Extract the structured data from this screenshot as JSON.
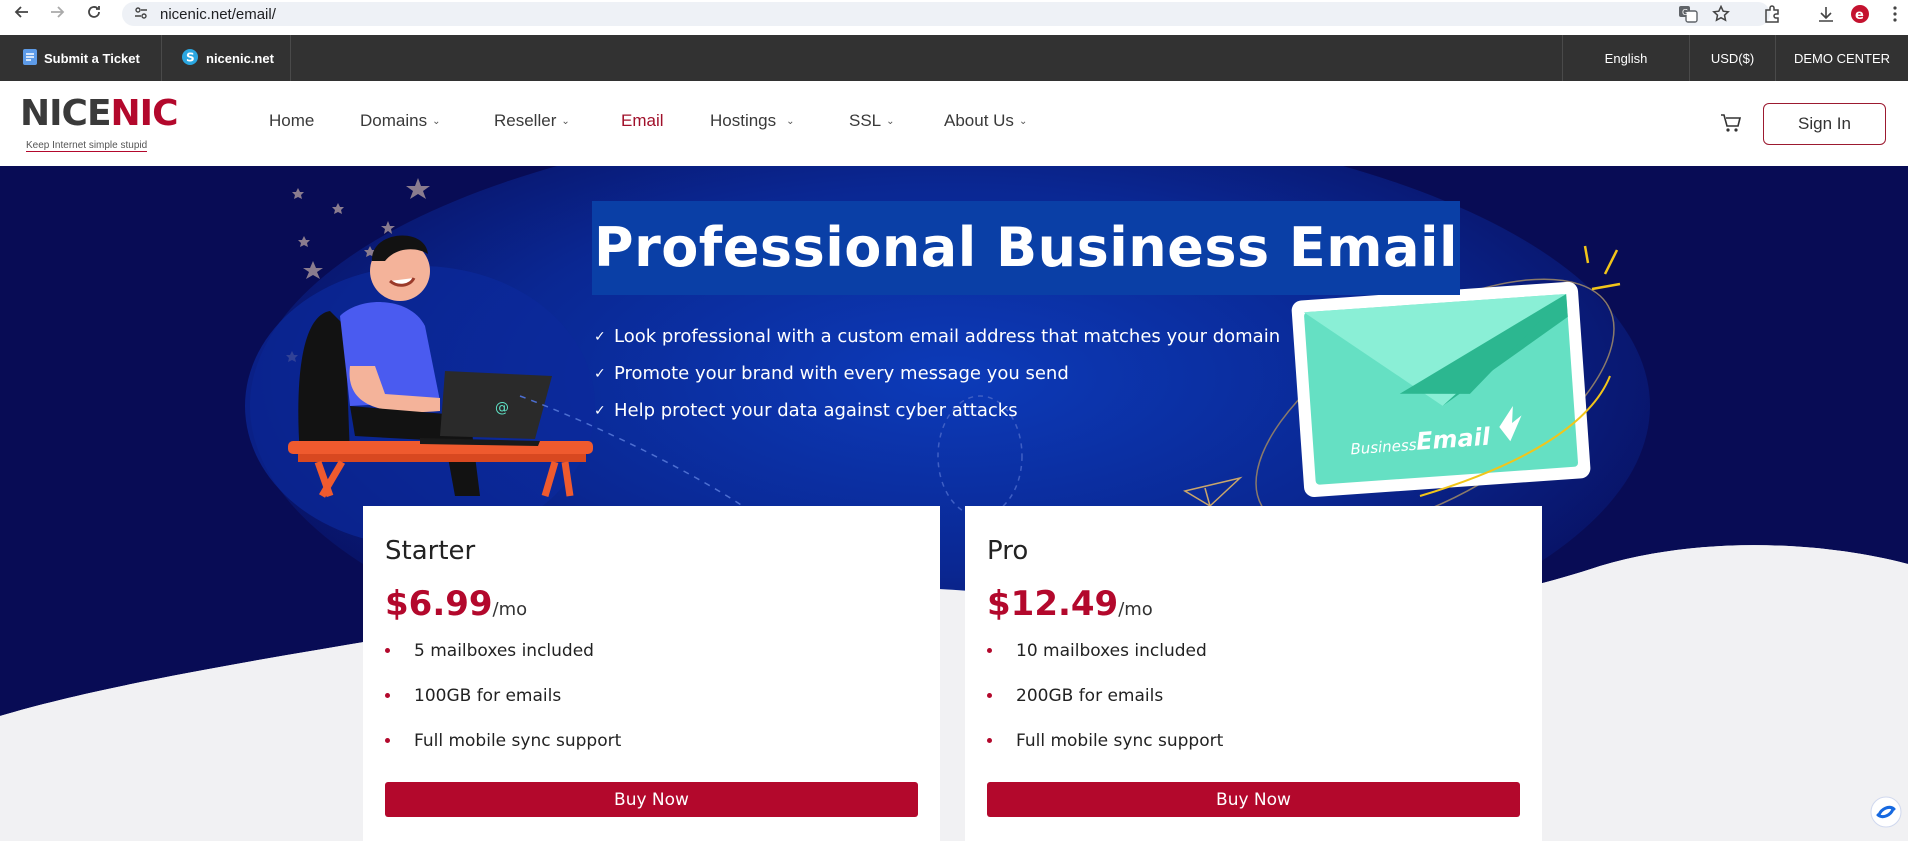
{
  "browser": {
    "url": "nicenic.net/email/"
  },
  "topbar": {
    "ticket_label": "Submit a Ticket",
    "site_label": "nicenic.net",
    "language": "English",
    "currency": "USD($)",
    "demo": "DEMO CENTER"
  },
  "header": {
    "logo_text_1": "NICE",
    "logo_text_2": "NIC",
    "logo_tagline": "Keep Internet simple stupid",
    "nav": [
      {
        "label": "Home",
        "dropdown": false
      },
      {
        "label": "Domains",
        "dropdown": true
      },
      {
        "label": "Reseller",
        "dropdown": true
      },
      {
        "label": "Email",
        "dropdown": false,
        "active": true
      },
      {
        "label": "Hostings",
        "dropdown": true
      },
      {
        "label": "SSL",
        "dropdown": true
      },
      {
        "label": "About Us",
        "dropdown": true
      }
    ],
    "signin_label": "Sign In"
  },
  "hero": {
    "title": "Professional Business Email",
    "bullets": [
      "Look professional with a custom email address that matches your domain",
      "Promote your brand with every message you send",
      "Help protect your data against cyber attacks"
    ],
    "envelope_word_1": "Business",
    "envelope_word_2": "Email",
    "laptop_symbol": "@"
  },
  "plans": [
    {
      "name": "Starter",
      "price": "$6.99",
      "period": "/mo",
      "features": [
        "5 mailboxes included",
        "100GB for emails",
        "Full mobile sync support"
      ],
      "button": "Buy Now"
    },
    {
      "name": "Pro",
      "price": "$12.49",
      "period": "/mo",
      "features": [
        "10 mailboxes included",
        "200GB for emails",
        "Full mobile sync support"
      ],
      "button": "Buy Now"
    }
  ],
  "colors": {
    "brand_red": "#b3082c",
    "hero_dark": "#0a0f5a",
    "topbar": "#323232"
  }
}
